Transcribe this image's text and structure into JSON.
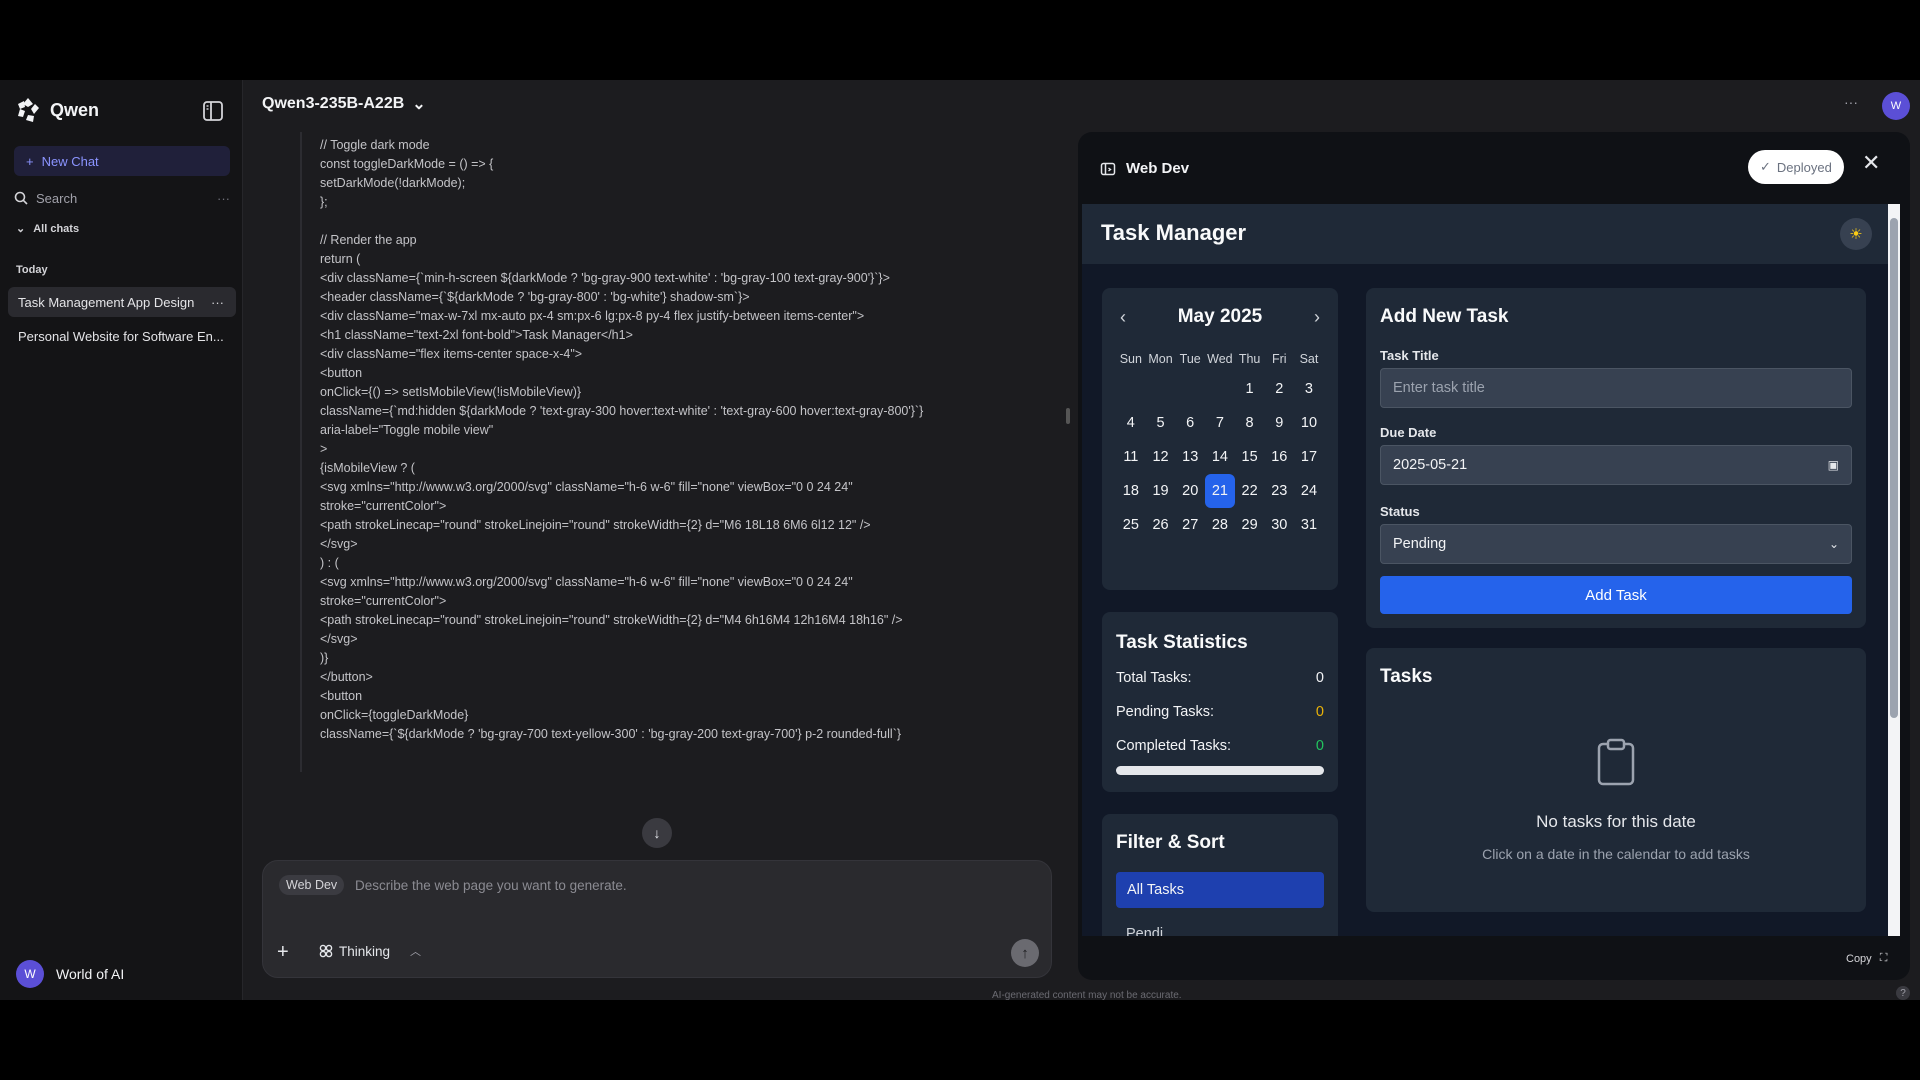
{
  "sidebar": {
    "brand": "Qwen",
    "new_chat": "New Chat",
    "search": "Search",
    "all_chats": "All chats",
    "section_today": "Today",
    "chats": [
      {
        "label": "Task Management App Design",
        "active": true
      },
      {
        "label": "Personal Website for Software En...",
        "active": false
      }
    ],
    "user": {
      "initial": "W",
      "name": "World of AI"
    }
  },
  "header": {
    "model": "Qwen3-235B-A22B",
    "avatar_initial": "W"
  },
  "code": {
    "lines": [
      "// Toggle dark mode",
      "const toggleDarkMode = () => {",
      "setDarkMode(!darkMode);",
      "};",
      "",
      "// Render the app",
      "return (",
      "<div className={`min-h-screen ${darkMode ? 'bg-gray-900 text-white' : 'bg-gray-100 text-gray-900'}`}>",
      "<header className={`${darkMode ? 'bg-gray-800' : 'bg-white'} shadow-sm`}>",
      "<div className=\"max-w-7xl mx-auto px-4 sm:px-6 lg:px-8 py-4 flex justify-between items-center\">",
      "<h1 className=\"text-2xl font-bold\">Task Manager</h1>",
      "<div className=\"flex items-center space-x-4\">",
      "<button",
      "onClick={() => setIsMobileView(!isMobileView)}",
      "className={`md:hidden ${darkMode ? 'text-gray-300 hover:text-white' : 'text-gray-600 hover:text-gray-800'}`}",
      "aria-label=\"Toggle mobile view\"",
      ">",
      "{isMobileView ? (",
      "<svg xmlns=\"http://www.w3.org/2000/svg\" className=\"h-6 w-6\" fill=\"none\" viewBox=\"0 0 24 24\"",
      "stroke=\"currentColor\">",
      "<path strokeLinecap=\"round\" strokeLinejoin=\"round\" strokeWidth={2} d=\"M6 18L18 6M6 6l12 12\" />",
      "</svg>",
      ") : (",
      "<svg xmlns=\"http://www.w3.org/2000/svg\" className=\"h-6 w-6\" fill=\"none\" viewBox=\"0 0 24 24\"",
      "stroke=\"currentColor\">",
      "<path strokeLinecap=\"round\" strokeLinejoin=\"round\" strokeWidth={2} d=\"M4 6h16M4 12h16M4 18h16\" />",
      "</svg>",
      ")}",
      "</button>",
      "<button",
      "onClick={toggleDarkMode}",
      "className={`${darkMode ? 'bg-gray-700 text-yellow-300' : 'bg-gray-200 text-gray-700'} p-2 rounded-full`}"
    ]
  },
  "composer": {
    "tag": "Web Dev",
    "placeholder": "Describe the web page you want to generate.",
    "thinking": "Thinking"
  },
  "disclaimer": "AI-generated content may not be accurate.",
  "webdev": {
    "title": "Web Dev",
    "deployed": "Deployed",
    "copy": "Copy"
  },
  "app": {
    "title": "Task Manager",
    "calendar": {
      "month": "May 2025",
      "weekdays": [
        "Sun",
        "Mon",
        "Tue",
        "Wed",
        "Thu",
        "Fri",
        "Sat"
      ],
      "weeks": [
        [
          "",
          "",
          "",
          "",
          "1",
          "2",
          "3"
        ],
        [
          "4",
          "5",
          "6",
          "7",
          "8",
          "9",
          "10"
        ],
        [
          "11",
          "12",
          "13",
          "14",
          "15",
          "16",
          "17"
        ],
        [
          "18",
          "19",
          "20",
          "21",
          "22",
          "23",
          "24"
        ],
        [
          "25",
          "26",
          "27",
          "28",
          "29",
          "30",
          "31"
        ]
      ],
      "selected": "21"
    },
    "stats": {
      "title": "Task Statistics",
      "total_label": "Total Tasks:",
      "total": "0",
      "pending_label": "Pending Tasks:",
      "pending": "0",
      "completed_label": "Completed Tasks:",
      "completed": "0",
      "colors": {
        "pending": "#eab308",
        "completed": "#22c55e"
      }
    },
    "filter": {
      "title": "Filter & Sort",
      "active": "All Tasks",
      "next_partial": "Pendi..."
    },
    "add_task": {
      "title": "Add New Task",
      "title_label": "Task Title",
      "title_placeholder": "Enter task title",
      "due_label": "Due Date",
      "due_value": "2025-05-21",
      "status_label": "Status",
      "status_value": "Pending",
      "button": "Add Task"
    },
    "tasks": {
      "title": "Tasks",
      "empty_title": "No tasks for this date",
      "empty_sub": "Click on a date in the calendar to add tasks"
    }
  }
}
